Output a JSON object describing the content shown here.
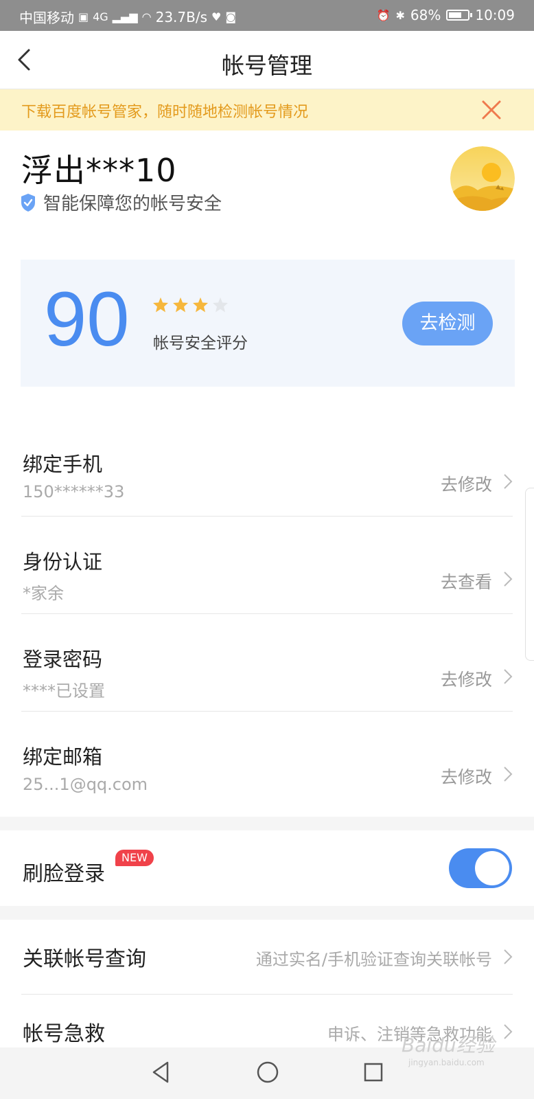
{
  "status_bar": {
    "carrier": "中国移动",
    "network": "4G",
    "speed": "23.7B/s",
    "battery": "68%",
    "battery_level": 0.68,
    "time": "10:09"
  },
  "nav": {
    "title": "帐号管理"
  },
  "banner": {
    "text": "下载百度帐号管家，随时随地检测帐号情况"
  },
  "profile": {
    "username": "浮出***10",
    "secure_text": "智能保障您的帐号安全"
  },
  "score_card": {
    "score": "90",
    "stars": 3,
    "max_stars": 4,
    "label": "帐号安全评分",
    "button": "去检测"
  },
  "settings": [
    {
      "title": "绑定手机",
      "value": "150******33",
      "action": "去修改"
    },
    {
      "title": "身份认证",
      "value": "*家余",
      "action": "去查看"
    },
    {
      "title": "登录密码",
      "value": "****已设置",
      "action": "去修改"
    },
    {
      "title": "绑定邮箱",
      "value": "25...1@qq.com",
      "action": "去修改"
    }
  ],
  "face_login": {
    "title": "刷脸登录",
    "badge": "NEW",
    "enabled": true
  },
  "related": {
    "title": "关联帐号查询",
    "desc": "通过实名/手机验证查询关联帐号"
  },
  "rescue": {
    "title": "帐号急救",
    "desc": "申诉、注销等急救功能"
  },
  "watermark": {
    "text": "Baidu经验",
    "sub": "jingyan.baidu.com"
  },
  "colors": {
    "accent": "#4a8cf0",
    "banner_bg": "#fdf3c8",
    "banner_text": "#e39a1c",
    "badge": "#f0424a",
    "star": "#f6b73c"
  }
}
